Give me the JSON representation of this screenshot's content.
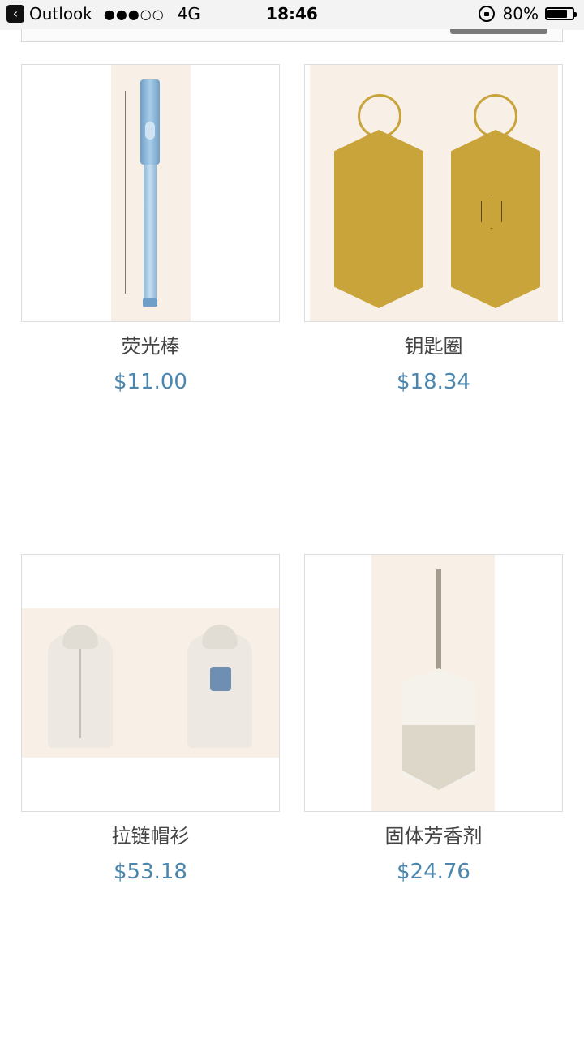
{
  "status_bar": {
    "back_app": "Outlook",
    "signal": "●●●○○",
    "network": "4G",
    "time": "18:46",
    "battery_percent": "80%",
    "battery_level": 0.8
  },
  "products": [
    {
      "name": "荧光棒",
      "price": "$11.00",
      "image": "glow-stick-image"
    },
    {
      "name": "钥匙圈",
      "price": "$18.34",
      "image": "keyring-image"
    },
    {
      "name": "拉链帽衫",
      "price": "$53.18",
      "image": "zip-hoodie-image"
    },
    {
      "name": "固体芳香剂",
      "price": "$24.76",
      "image": "solid-aroma-image"
    }
  ],
  "colors": {
    "price": "#4a86ad",
    "name": "#444444",
    "image_background": "#f8efe7"
  }
}
